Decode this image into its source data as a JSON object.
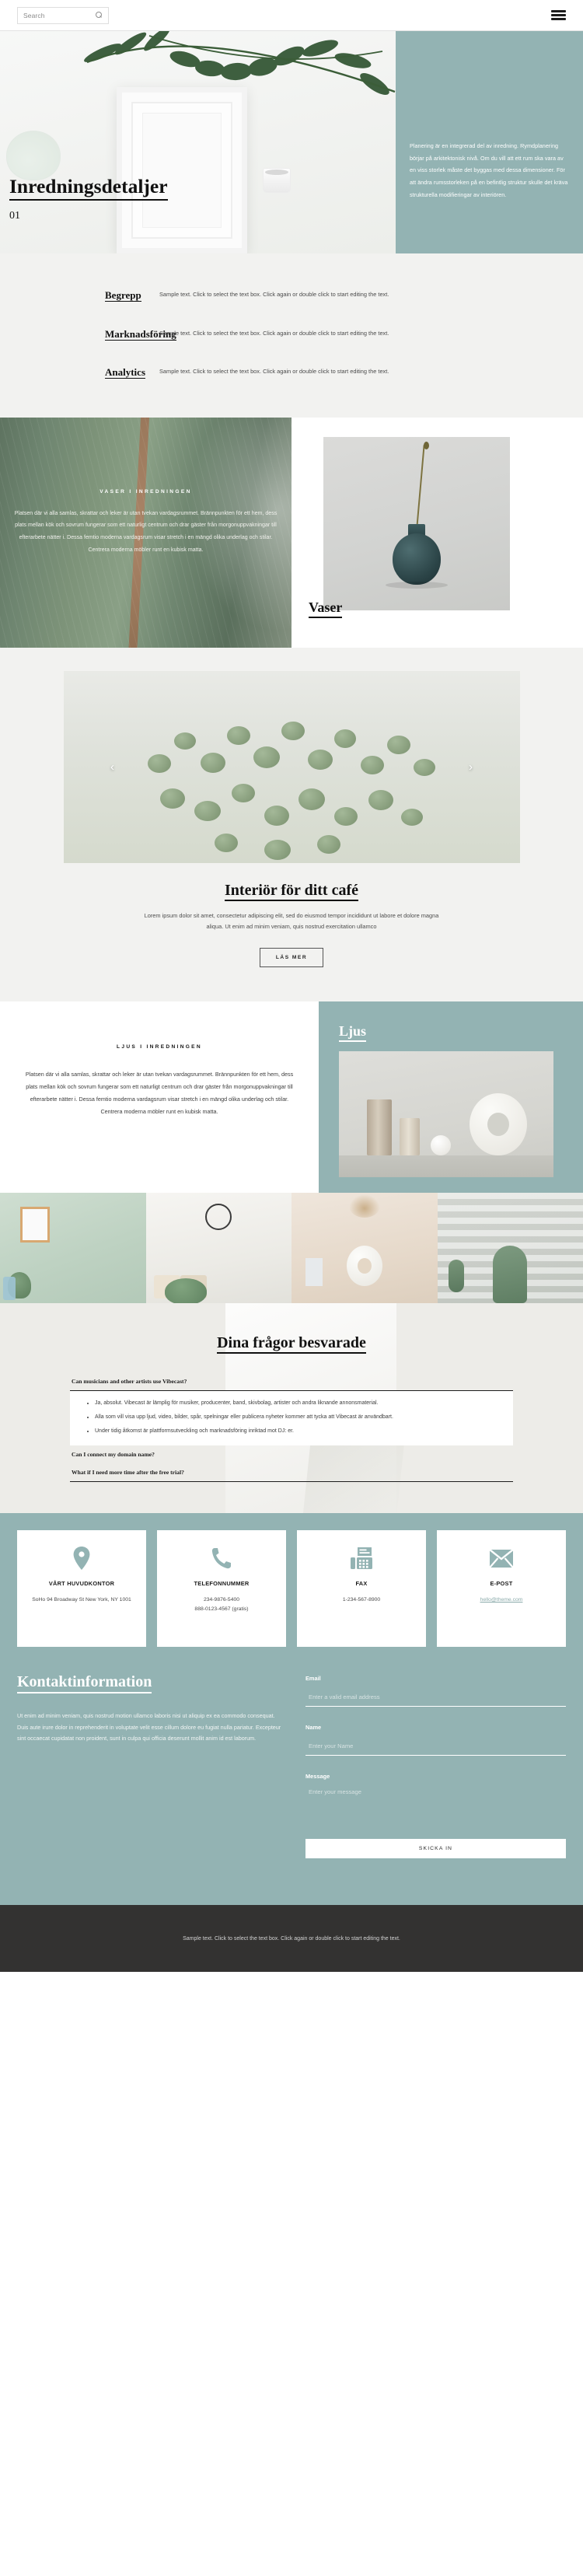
{
  "header": {
    "search_placeholder": "Search",
    "search_value": "",
    "menu_label": "Menu"
  },
  "hero": {
    "title": "Inredningsdetaljer",
    "number": "01",
    "panel_text": "Planering är en integrerad del av inredning. Rymdplanering börjar på arkitektonisk nivå. Om du vill att ett rum ska vara av en viss storlek måste det byggas med dessa dimensioner. För att ändra rumsstorleken på en befintlig struktur skulle det kräva strukturella modifieringar av interiören."
  },
  "features": [
    {
      "title": "Begrepp",
      "desc": "Sample text. Click to select the text box. Click again or double click to start editing the text."
    },
    {
      "title": "Marknadsföring",
      "desc": "Sample text. Click to select the text box. Click again or double click to start editing the text."
    },
    {
      "title": "Analytics",
      "desc": "Sample text. Click to select the text box. Click again or double click to start editing the text."
    }
  ],
  "leaf_section": {
    "kicker": "VASER I INREDNINGEN",
    "body": "Platsen där vi alla samlas, skrattar och leker är utan tvekan vardagsrummet. Brännpunkten för ett hem, dess plats mellan kök och sovrum fungerar som ett naturligt centrum och drar gäster från morgonuppvakningar till efterarbete nätter i. Dessa femtio moderna vardagsrum visar stretch i en mängd olika underlag och stilar. Centrera moderna möbler runt en kubisk matta.",
    "label": "Vaser"
  },
  "cafe": {
    "prev_icon": "chevron-left-icon",
    "next_icon": "chevron-right-icon",
    "title": "Interiör för ditt café",
    "subtitle": "Lorem ipsum dolor sit amet, consectetur adipiscing elit, sed do eiusmod tempor incididunt ut labore et dolore magna aliqua. Ut enim ad minim veniam, quis nostrud exercitation ullamco",
    "button": "LÄS MER"
  },
  "ljus_section": {
    "kicker": "LJUS I INREDNINGEN",
    "body": "Platsen där vi alla samlas, skrattar och leker är utan tvekan vardagsrummet. Brännpunkten för ett hem, dess plats mellan kök och sovrum fungerar som ett naturligt centrum och drar gäster från morgonuppvakningar till efterarbete nätter i. Dessa femtio moderna vardagsrum visar stretch i en mängd olika underlag och stilar. Centrera moderna möbler runt en kubisk matta.",
    "label": "Ljus"
  },
  "faq": {
    "title": "Dina frågor besvarade",
    "items": [
      {
        "question": "Can musicians and other artists use Vibecast?",
        "open": true,
        "answers": [
          "Ja, absolut. Vibecast är lämplig för musiker, producenter, band, skivbolag, artister och andra liknande annonsmaterial.",
          "Alla som vill visa upp ljud, video, bilder, spår, spelningar eller publicera nyheter kommer att tycka att Vibecast är användbart.",
          "Under tidig åtkomst är plattformsutveckling och marknadsföring inriktad mot DJ: er."
        ]
      },
      {
        "question": "Can I connect my domain name?",
        "open": false,
        "answers": []
      },
      {
        "question": "What if I need more time after the free trial?",
        "open": false,
        "answers": []
      }
    ]
  },
  "contact_cards": [
    {
      "icon": "location-pin-icon",
      "title": "VÅRT HUVUDKONTOR",
      "value": "SoHo 94 Broadway St New York, NY 1001",
      "is_link": false
    },
    {
      "icon": "phone-icon",
      "title": "TELEFONNUMMER",
      "value": "234-9876-5400\n888-0123-4567 (gratis)",
      "is_link": false
    },
    {
      "icon": "fax-icon",
      "title": "FAX",
      "value": "1-234-567-8900",
      "is_link": false
    },
    {
      "icon": "envelope-icon",
      "title": "E-POST",
      "value": "hello@theme.com",
      "is_link": true
    }
  ],
  "contact_form": {
    "heading": "Kontaktinformation",
    "body": "Ut enim ad minim veniam, quis nostrud motion ullamco laboris nisi ut aliquip ex ea commodo consequat. Duis aute irure dolor in reprehenderit in voluptate velit esse cillum dolore eu fugiat nulla pariatur. Excepteur sint occaecat cupidatat non proident, sunt in culpa qui officia deserunt mollit anim id est laborum.",
    "fields": [
      {
        "label": "Email",
        "placeholder": "Enter a valid email address",
        "value": ""
      },
      {
        "label": "Name",
        "placeholder": "Enter your Name",
        "value": ""
      },
      {
        "label": "Message",
        "placeholder": "Enter your message",
        "value": ""
      }
    ],
    "submit": "SKICKA IN"
  },
  "footer": {
    "text": "Sample text. Click to select the text box. Click again or double click to start editing the text."
  },
  "colors": {
    "teal": "#93b3b3",
    "dark_footer": "#333231",
    "light_bg": "#f2f2f0",
    "faq_bg": "#edece8"
  }
}
